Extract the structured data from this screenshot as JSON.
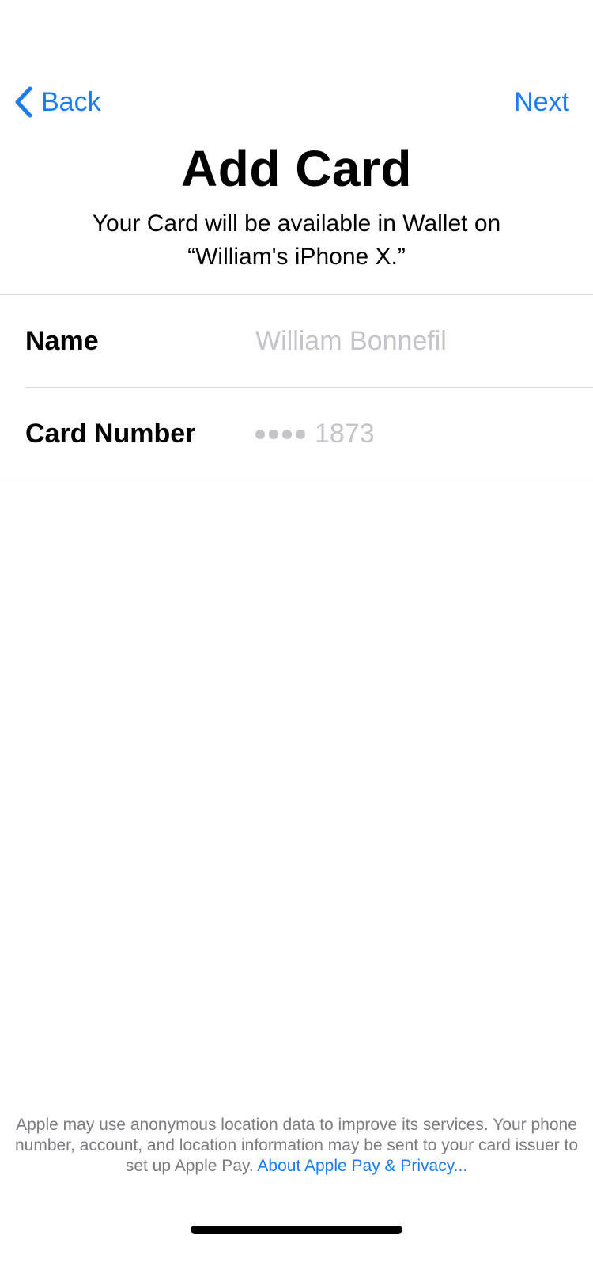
{
  "nav": {
    "back_label": "Back",
    "next_label": "Next",
    "accent_color": "#1a7cf0"
  },
  "header": {
    "title": "Add Card",
    "subtitle_line1": "Your Card will be available in Wallet on",
    "subtitle_line2": "“William's iPhone X.”"
  },
  "form": {
    "rows": [
      {
        "label": "Name",
        "value": "William Bonnefil"
      },
      {
        "label": "Card Number",
        "value": "1873",
        "masked_dots": 4
      }
    ]
  },
  "footer": {
    "note": "Apple may use anonymous location data to improve its services. Your phone number, account, and location information may be sent to your card issuer to set up Apple Pay. ",
    "link_label": "About Apple Pay & Privacy..."
  }
}
